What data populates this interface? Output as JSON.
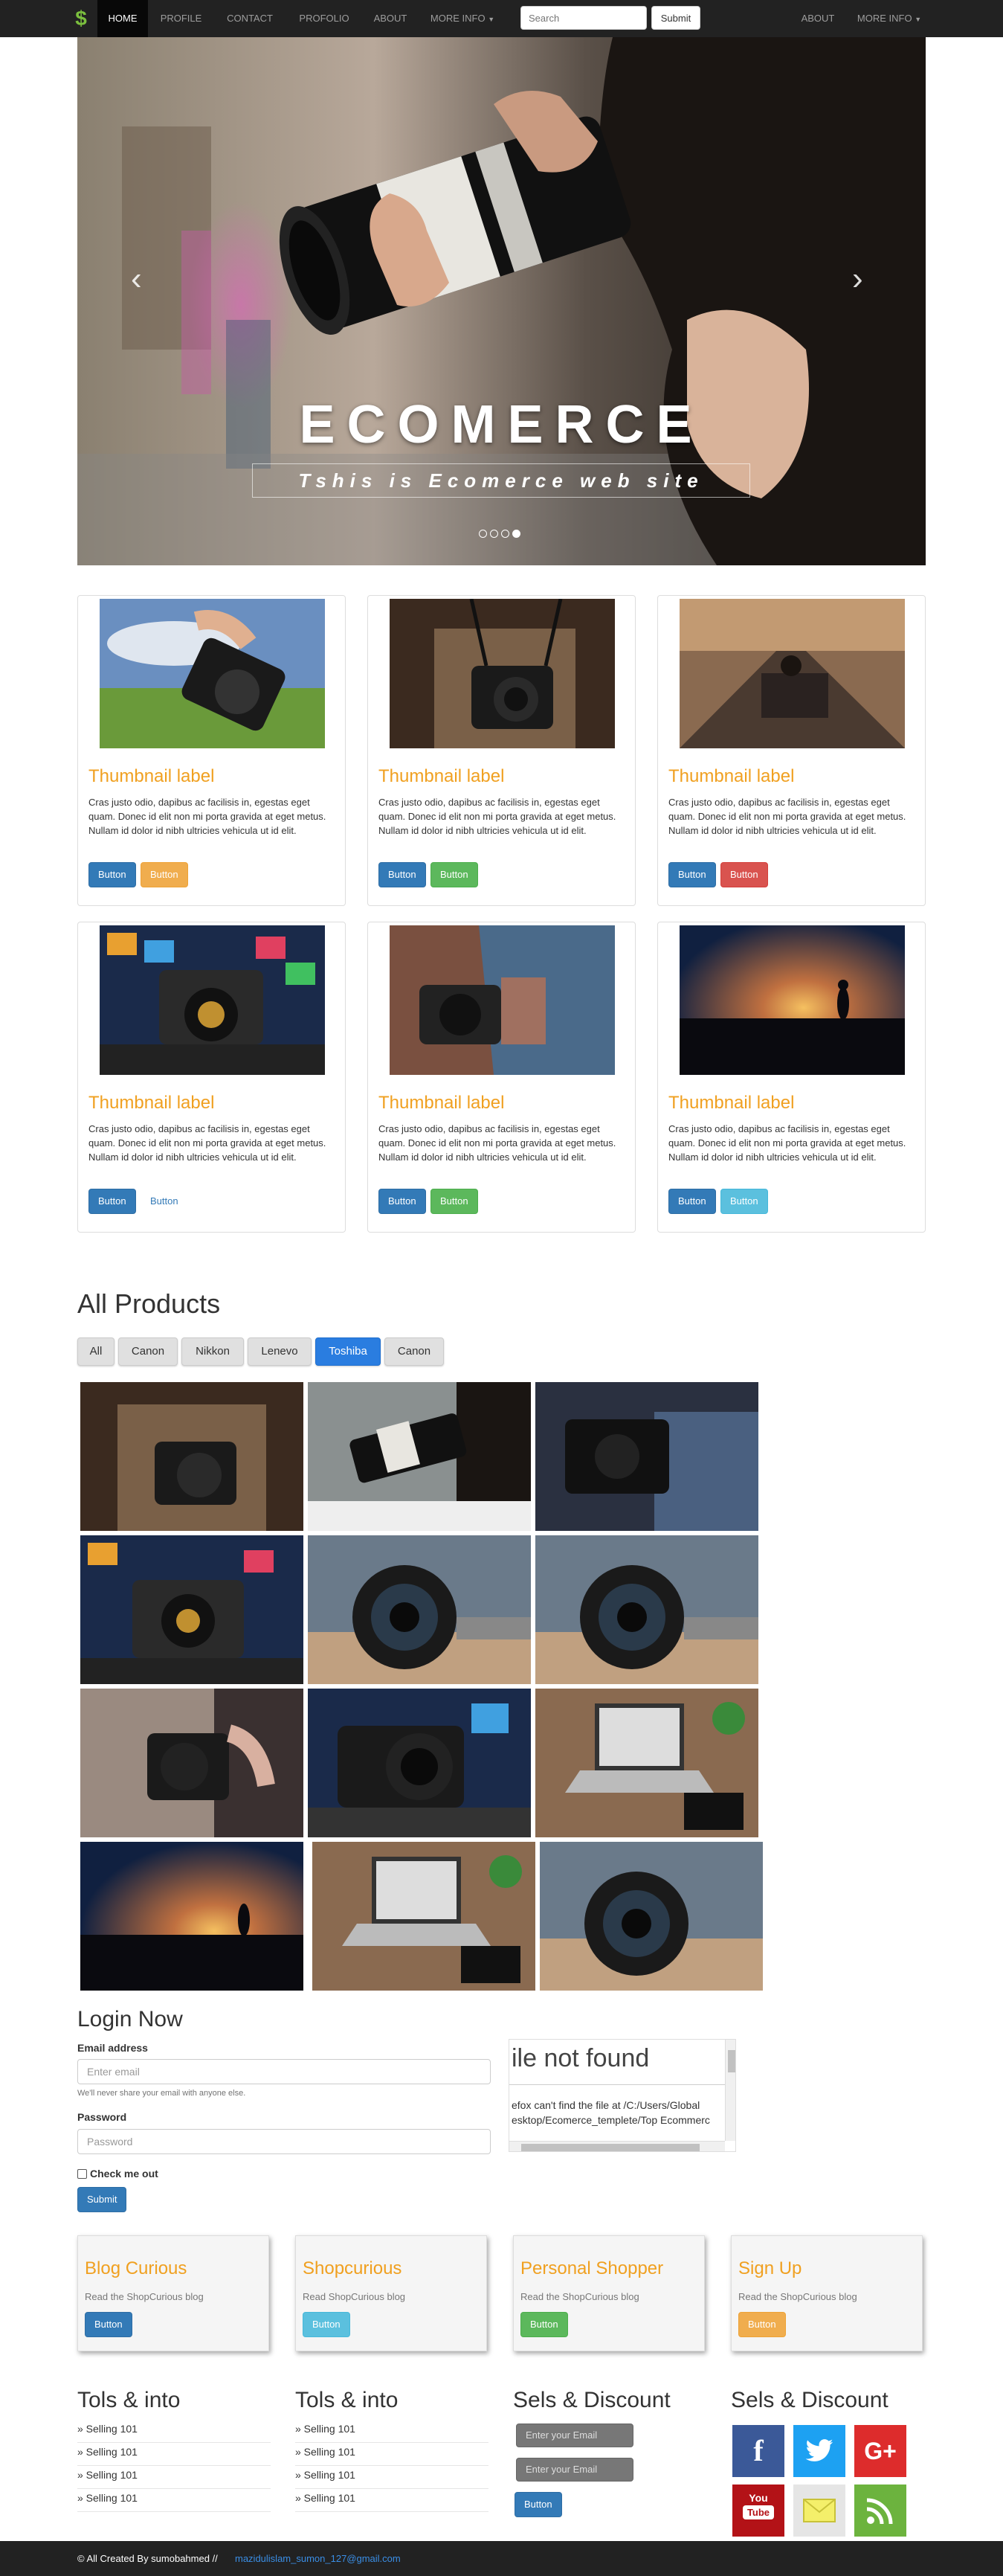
{
  "navbar": {
    "items": [
      "HOME",
      "PROFILE",
      "CONTACT",
      "PROFOLIO",
      "ABOUT",
      "MORE INFO"
    ],
    "search_placeholder": "Search",
    "submit_label": "Submit",
    "right_items": [
      "ABOUT",
      "MORE INFO"
    ]
  },
  "carousel": {
    "title": "ECOMERCE",
    "subtitle": "Tshis is Ecomerce web site",
    "prev_icon": "chevron-left-icon",
    "next_icon": "chevron-right-icon",
    "slide_count": 4,
    "active_slide": 4
  },
  "thumbnails": [
    {
      "label": "Thumbnail label",
      "text": "Cras justo odio, dapibus ac facilisis in, egestas eget quam. Donec id elit non mi porta gravida at eget metus. Nullam id dolor id nibh ultricies vehicula ut id elit.",
      "btn1": "Button",
      "btn2": "Button"
    },
    {
      "label": "Thumbnail label",
      "text": "Cras justo odio, dapibus ac facilisis in, egestas eget quam. Donec id elit non mi porta gravida at eget metus. Nullam id dolor id nibh ultricies vehicula ut id elit.",
      "btn1": "Button",
      "btn2": "Button"
    },
    {
      "label": "Thumbnail label",
      "text": "Cras justo odio, dapibus ac facilisis in, egestas eget quam. Donec id elit non mi porta gravida at eget metus. Nullam id dolor id nibh ultricies vehicula ut id elit.",
      "btn1": "Button",
      "btn2": "Button"
    },
    {
      "label": "Thumbnail label",
      "text": "Cras justo odio, dapibus ac facilisis in, egestas eget quam. Donec id elit non mi porta gravida at eget metus. Nullam id dolor id nibh ultricies vehicula ut id elit.",
      "btn1": "Button",
      "btn2": "Button"
    },
    {
      "label": "Thumbnail label",
      "text": "Cras justo odio, dapibus ac facilisis in, egestas eget quam. Donec id elit non mi porta gravida at eget metus. Nullam id dolor id nibh ultricies vehicula ut id elit.",
      "btn1": "Button",
      "btn2": "Button"
    },
    {
      "label": "Thumbnail label",
      "text": "Cras justo odio, dapibus ac facilisis in, egestas eget quam. Donec id elit non mi porta gravida at eget metus. Nullam id dolor id nibh ultricies vehicula ut id elit.",
      "btn1": "Button",
      "btn2": "Button"
    }
  ],
  "products": {
    "heading": "All Products",
    "filters": [
      "All",
      "Canon",
      "Nikkon",
      "Lenevo",
      "Toshiba",
      "Canon"
    ],
    "active_filter": "Toshiba"
  },
  "login": {
    "heading": "Login Now",
    "email_label": "Email address",
    "email_placeholder": "Enter email",
    "email_help": "We'll never share your email with anyone else.",
    "password_label": "Password",
    "password_placeholder": "Password",
    "check_label": "Check me out",
    "submit_label": "Submit"
  },
  "embed": {
    "title": "ile not found",
    "line1": "efox can't find the file at /C:/Users/Global",
    "line2": "esktop/Ecomerce_templete/Top Ecommerc"
  },
  "cards": [
    {
      "title": "Blog Curious",
      "text": "Read the ShopCurious blog",
      "button": "Button"
    },
    {
      "title": "Shopcurious",
      "text": "Read ShopCurious blog",
      "button": "Button"
    },
    {
      "title": "Personal Shopper",
      "text": "Read the ShopCurious blog",
      "button": "Button"
    },
    {
      "title": "Sign Up",
      "text": "Read the ShopCurious blog",
      "button": "Button"
    }
  ],
  "footer": {
    "col1_heading": "Tols & into",
    "col2_heading": "Tols & into",
    "col3_heading": "Sels & Discount",
    "col4_heading": "Sels & Discount",
    "links": [
      "» Selling 101",
      "» Selling 101",
      "» Selling 101",
      "» Selling 101"
    ],
    "email_placeholder": "Enter your Email",
    "email_placeholder2": "Enter your Email",
    "newsletter_button": "Button",
    "social": [
      "f",
      "t",
      "G+",
      "YouTube",
      "mail",
      "rss"
    ],
    "copyright": "© All Created By sumobahmed //",
    "email": "mazidulislam_sumon_127@gmail.com"
  }
}
